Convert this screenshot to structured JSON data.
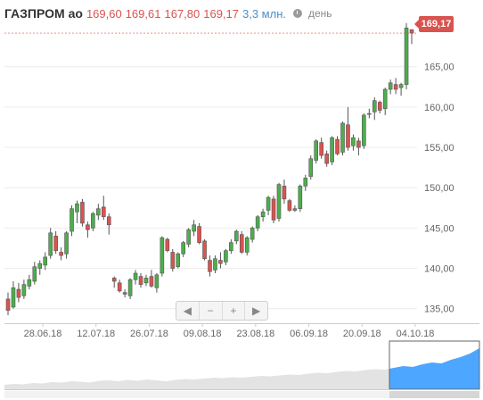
{
  "header": {
    "ticker": "ГАЗПРОМ ао",
    "open": "169,60",
    "high": "169,61",
    "low": "167,80",
    "close": "169,17",
    "volume": "3,3 млн.",
    "period": "день"
  },
  "last_price_label": "169,17",
  "navigator_buttons": {
    "left": "◀",
    "zoom_out": "−",
    "zoom_in": "+",
    "right": "▶"
  },
  "colors": {
    "up": "#4cae4c",
    "down": "#d9534f",
    "grid": "#ececec",
    "navigator": "#4da6ff"
  },
  "chart_data": {
    "type": "candlestick",
    "ylim": [
      133.2,
      171.5
    ],
    "y_ticks": [
      "135,00",
      "140,00",
      "145,00",
      "150,00",
      "155,00",
      "160,00",
      "165,00"
    ],
    "x_ticks": [
      "28.06.18",
      "12.07.18",
      "26.07.18",
      "09.08.18",
      "23.08.18",
      "06.09.18",
      "20.09.18",
      "04.10.18"
    ],
    "candles": [
      [
        136.2,
        137.0,
        134.2,
        134.8
      ],
      [
        135.2,
        138.4,
        135.0,
        137.6
      ],
      [
        137.4,
        138.2,
        135.8,
        136.4
      ],
      [
        136.6,
        138.6,
        136.2,
        138.0
      ],
      [
        137.8,
        139.2,
        137.4,
        138.6
      ],
      [
        138.4,
        140.8,
        138.0,
        140.2
      ],
      [
        140.0,
        141.0,
        139.2,
        140.6
      ],
      [
        140.4,
        142.0,
        139.8,
        141.4
      ],
      [
        141.6,
        145.0,
        141.2,
        144.4
      ],
      [
        144.0,
        144.6,
        141.8,
        142.2
      ],
      [
        142.0,
        142.6,
        141.0,
        141.6
      ],
      [
        141.8,
        144.6,
        141.2,
        144.4
      ],
      [
        144.6,
        147.8,
        144.0,
        147.4
      ],
      [
        147.0,
        148.4,
        145.6,
        148.0
      ],
      [
        148.2,
        148.6,
        145.2,
        145.6
      ],
      [
        145.4,
        145.8,
        143.8,
        144.8
      ],
      [
        145.0,
        147.0,
        144.6,
        146.8
      ],
      [
        146.6,
        148.0,
        146.0,
        147.4
      ],
      [
        147.6,
        149.0,
        146.0,
        146.4
      ],
      [
        146.4,
        146.8,
        144.2,
        145.4
      ],
      [
        138.8,
        139.0,
        137.6,
        138.4
      ],
      [
        138.2,
        138.6,
        137.0,
        137.2
      ],
      [
        137.0,
        137.4,
        136.4,
        136.8
      ],
      [
        136.6,
        138.8,
        136.2,
        138.6
      ],
      [
        138.6,
        139.8,
        138.0,
        139.4
      ],
      [
        139.0,
        139.4,
        137.6,
        138.0
      ],
      [
        138.2,
        139.2,
        137.8,
        138.8
      ],
      [
        139.0,
        139.8,
        137.6,
        137.8
      ],
      [
        137.6,
        139.4,
        137.0,
        139.2
      ],
      [
        139.4,
        144.0,
        139.0,
        143.8
      ],
      [
        143.6,
        143.8,
        142.0,
        142.2
      ],
      [
        142.0,
        142.4,
        139.6,
        140.0
      ],
      [
        140.2,
        142.0,
        140.0,
        141.8
      ],
      [
        141.8,
        143.4,
        141.4,
        143.2
      ],
      [
        143.0,
        145.0,
        142.6,
        144.8
      ],
      [
        144.6,
        146.0,
        144.0,
        145.4
      ],
      [
        145.2,
        145.6,
        143.0,
        143.2
      ],
      [
        143.4,
        143.6,
        141.0,
        141.2
      ],
      [
        141.0,
        141.6,
        139.0,
        139.6
      ],
      [
        139.8,
        141.6,
        139.4,
        141.2
      ],
      [
        141.0,
        142.0,
        140.0,
        140.6
      ],
      [
        140.8,
        142.4,
        140.4,
        142.2
      ],
      [
        142.2,
        143.6,
        141.8,
        143.2
      ],
      [
        143.4,
        144.8,
        143.0,
        144.6
      ],
      [
        144.2,
        144.6,
        141.8,
        142.0
      ],
      [
        142.0,
        144.0,
        141.6,
        143.8
      ],
      [
        143.6,
        145.2,
        143.2,
        145.0
      ],
      [
        145.0,
        146.6,
        144.6,
        146.4
      ],
      [
        146.4,
        147.4,
        145.8,
        147.0
      ],
      [
        147.2,
        149.0,
        146.6,
        148.8
      ],
      [
        148.6,
        149.0,
        145.6,
        146.0
      ],
      [
        146.2,
        150.6,
        145.8,
        150.4
      ],
      [
        150.2,
        151.0,
        148.0,
        148.6
      ],
      [
        148.4,
        148.6,
        147.0,
        147.2
      ],
      [
        147.4,
        147.8,
        147.0,
        147.2
      ],
      [
        147.4,
        150.4,
        147.0,
        150.2
      ],
      [
        150.2,
        151.6,
        149.6,
        151.2
      ],
      [
        151.4,
        154.0,
        151.0,
        153.6
      ],
      [
        153.4,
        156.0,
        153.0,
        155.8
      ],
      [
        155.6,
        156.2,
        153.6,
        154.0
      ],
      [
        154.2,
        154.6,
        152.6,
        153.0
      ],
      [
        153.2,
        156.4,
        152.8,
        156.2
      ],
      [
        156.0,
        156.4,
        154.0,
        154.2
      ],
      [
        154.4,
        158.2,
        154.0,
        158.0
      ],
      [
        157.8,
        160.0,
        154.6,
        155.0
      ],
      [
        155.2,
        156.6,
        154.6,
        156.2
      ],
      [
        155.8,
        156.2,
        154.0,
        155.0
      ],
      [
        155.2,
        159.2,
        154.8,
        159.0
      ],
      [
        159.2,
        159.8,
        158.6,
        159.2
      ],
      [
        159.4,
        161.2,
        158.4,
        160.8
      ],
      [
        160.6,
        160.8,
        159.2,
        159.6
      ],
      [
        159.8,
        162.4,
        159.0,
        162.2
      ],
      [
        162.2,
        163.4,
        161.6,
        163.0
      ],
      [
        162.8,
        163.6,
        161.6,
        162.2
      ],
      [
        162.4,
        163.0,
        161.4,
        162.8
      ],
      [
        162.8,
        170.4,
        162.2,
        169.8
      ],
      [
        169.6,
        169.6,
        167.8,
        169.17
      ]
    ],
    "navigator_series": [
      0.1,
      0.12,
      0.11,
      0.14,
      0.13,
      0.16,
      0.15,
      0.18,
      0.17,
      0.15,
      0.19,
      0.2,
      0.18,
      0.21,
      0.19,
      0.22,
      0.2,
      0.18,
      0.21,
      0.23,
      0.22,
      0.24,
      0.26,
      0.25,
      0.27,
      0.26,
      0.28,
      0.3,
      0.29,
      0.31,
      0.33,
      0.32,
      0.35,
      0.37,
      0.36,
      0.39,
      0.41,
      0.4,
      0.43,
      0.45,
      0.44,
      0.48,
      0.52,
      0.5,
      0.56,
      0.6,
      0.58,
      0.66,
      0.72,
      0.8,
      0.92
    ]
  }
}
